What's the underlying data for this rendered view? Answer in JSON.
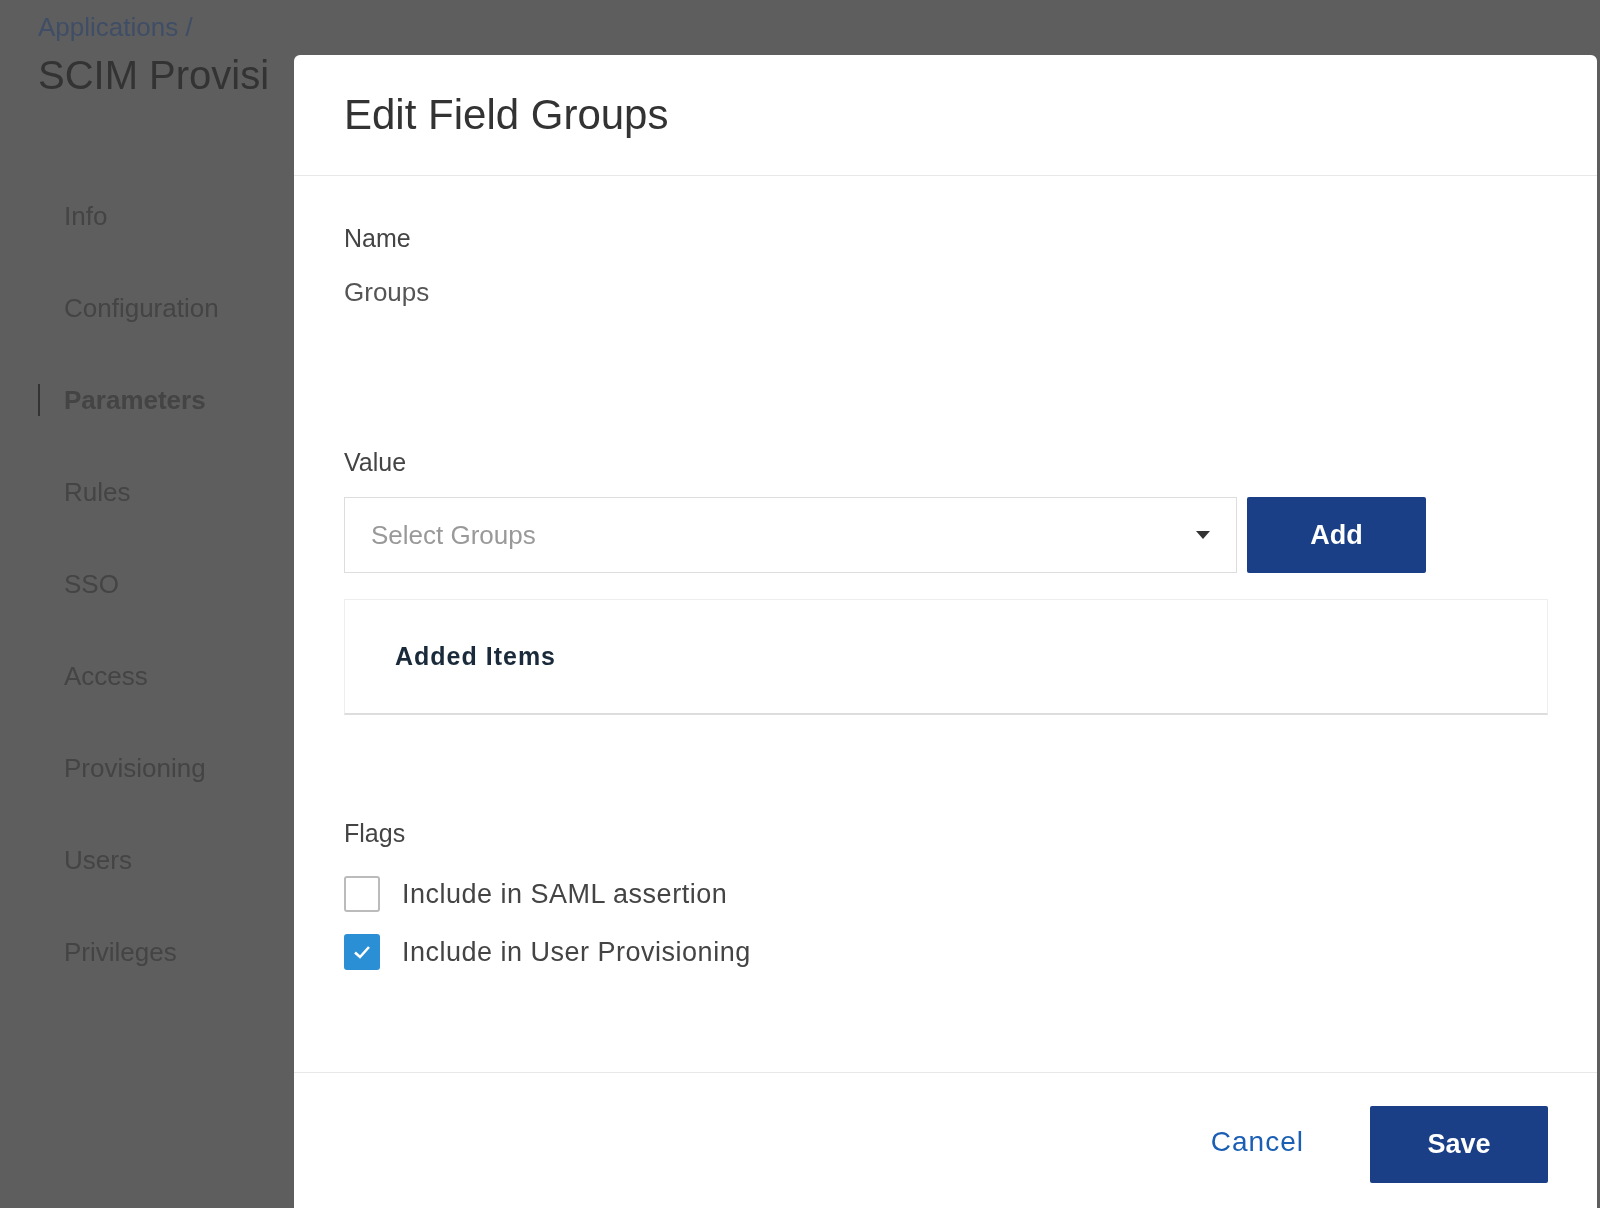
{
  "breadcrumb": "Applications /",
  "page_title": "SCIM Provisi",
  "sidebar": {
    "items": [
      {
        "label": "Info",
        "selected": false
      },
      {
        "label": "Configuration",
        "selected": false
      },
      {
        "label": "Parameters",
        "selected": true
      },
      {
        "label": "Rules",
        "selected": false
      },
      {
        "label": "SSO",
        "selected": false
      },
      {
        "label": "Access",
        "selected": false
      },
      {
        "label": "Provisioning",
        "selected": false
      },
      {
        "label": "Users",
        "selected": false
      },
      {
        "label": "Privileges",
        "selected": false
      }
    ]
  },
  "dialog": {
    "title": "Edit Field Groups",
    "name_label": "Name",
    "name_value": "Groups",
    "value_label": "Value",
    "select": {
      "placeholder": "Select Groups"
    },
    "add_button": "Add",
    "added_items_title": "Added Items",
    "flags_label": "Flags",
    "flags": [
      {
        "label": "Include in SAML assertion",
        "checked": false
      },
      {
        "label": "Include in User Provisioning",
        "checked": true
      }
    ],
    "cancel_button": "Cancel",
    "save_button": "Save"
  }
}
